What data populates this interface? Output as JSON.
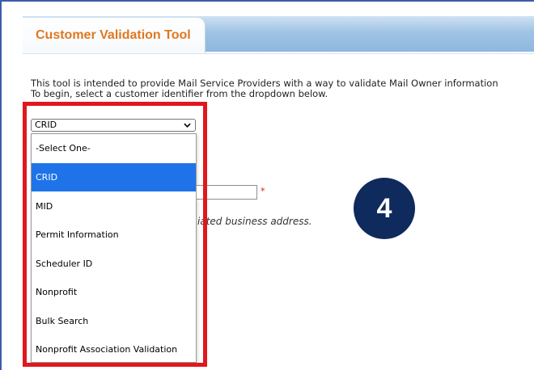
{
  "tab": {
    "title": "Customer Validation Tool"
  },
  "intro": {
    "line1": "This tool is intended to provide Mail Service Providers with a way to validate Mail Owner information",
    "line2": "To begin, select a customer identifier from the dropdown below."
  },
  "identifier_select": {
    "selected": "CRID",
    "options": [
      "-Select One-",
      "CRID",
      "MID",
      "Permit Information",
      "Scheduler ID",
      "Nonprofit",
      "Bulk Search",
      "Nonprofit Association Validation"
    ],
    "highlighted_index": 1
  },
  "form": {
    "required_marker": "*",
    "hint_text": "iated business address."
  },
  "annotation": {
    "step_number": "4",
    "highlight_color": "#e0171e",
    "badge_color": "#0f2a5c"
  },
  "colors": {
    "tab_title": "#e0781f",
    "selection": "#1e73e8",
    "header_band": "#9fc3e4"
  }
}
